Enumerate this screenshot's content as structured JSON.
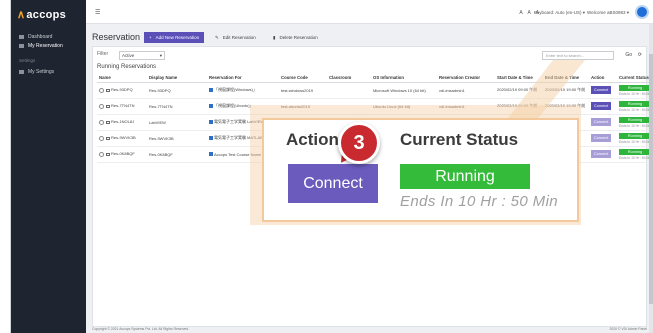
{
  "app": {
    "logo_text": "accops"
  },
  "sidebar": {
    "items": [
      {
        "label": "Dashboard"
      },
      {
        "label": "My Reservation"
      }
    ],
    "settings_label": "Settings",
    "settings_item": "My Settings",
    "footer": "Copyright © 2021 Accops Systems Pvt. Ltd. All Rights Reserved."
  },
  "topbar": {
    "font_size_controls": "A A A",
    "keyboard": "Keyboard: Auto (en-US) ▾",
    "welcome": "Welcome aBS0983 ▾"
  },
  "page": {
    "title": "Reservation",
    "add_new": "Add New Reservation",
    "edit": "Edit Reservation",
    "delete": "Delete Reservation"
  },
  "filter": {
    "label": "Filter",
    "value": "Active",
    "search_placeholder": "Enter text to search...",
    "go": "Go",
    "refresh_icon": "refresh-icon"
  },
  "section_title": "Running Reservations",
  "table": {
    "headers": [
      "Name",
      "Display Name",
      "Reservation For",
      "Course Code",
      "Classroom",
      "OS Information",
      "Reservation Creator",
      "Start Date & Time",
      "End Date & Time",
      "Action",
      "Current Status"
    ],
    "rows": [
      {
        "name": "Res-93DPQ",
        "display": "Res-93DPQ",
        "for": "「視窗課程(Windows)」",
        "code": "test-windows2019",
        "classroom": "",
        "os": "Microsoft Windows 10 (64 bit)",
        "creator": "vdi-imsadmin1",
        "start": "2020/02/19 09:00 午前",
        "end": "2020/02/19 19:00 午前",
        "action": "Connect",
        "status": "Running",
        "ends": "Ends In 10 Hr : 50 Min"
      },
      {
        "name": "Res-7TN4TN",
        "display": "Res-7TN4TN",
        "for": "「視窗課程(Ubuntu)」",
        "code": "test-ubuntu2019",
        "classroom": "",
        "os": "Ubuntu Linux (64 bit)",
        "creator": "vdi-imsadmin1",
        "start": "2020/02/19 09:00 午前",
        "end": "2020/02/19 19:00 午前",
        "action": "Connect",
        "status": "Running",
        "ends": "Ends In 10 Hr : 50 Min"
      },
      {
        "name": "Res-1NOL8J",
        "display": "LabVIEW",
        "for": "電気電子工学実験 LabVIEW",
        "code": "",
        "classroom": "",
        "os": "",
        "creator": "",
        "start": "",
        "end": "",
        "action": "Connect",
        "status": "Running",
        "ends": "Ends In 10 Hr : 50 Min"
      },
      {
        "name": "Res-9WVK3B",
        "display": "Res-9WVK3B",
        "for": "電気電子工学実験 MATLAB",
        "code": "",
        "classroom": "",
        "os": "",
        "creator": "",
        "start": "",
        "end": "",
        "action": "Connect",
        "status": "Running",
        "ends": "Ends In 10 Hr : 50 Min"
      },
      {
        "name": "Res-0K8BQF",
        "display": "Res-0K8BQF",
        "for": "Accops Test Course Name",
        "code": "",
        "classroom": "",
        "os": "",
        "creator": "",
        "start": "",
        "end": "",
        "action": "Connect",
        "status": "Running",
        "ends": "Ends In 10 Hr : 50 Min"
      }
    ]
  },
  "footer_right": "2020 © VDI Admin Panel",
  "callout": {
    "step_number": "3",
    "action_header": "Action",
    "status_header": "Current Status",
    "connect_label": "Connect",
    "status_label": "Running",
    "ends_text": "Ends In 10 Hr : 50 Min"
  },
  "colors": {
    "accent": "#6a5bbd",
    "running": "#33bb39",
    "badge": "#c92a2f",
    "callout_border": "#f3c89b",
    "sidebar": "#1f2530"
  }
}
